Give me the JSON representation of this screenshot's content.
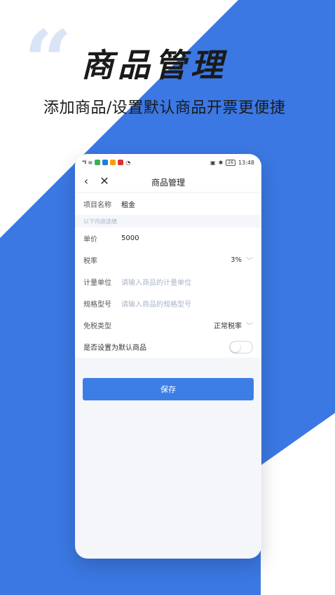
{
  "hero": {
    "quote_glyph": "“",
    "title": "商品管理",
    "subtitle": "添加商品/设置默认商品开票更便捷"
  },
  "colors": {
    "accent": "#3d7ee6",
    "background_blue": "#3b78e3"
  },
  "status_bar": {
    "signal": "⁴⁶ıl",
    "time": "13:48",
    "battery": "26"
  },
  "nav": {
    "title": "商品管理"
  },
  "form": {
    "project_name": {
      "label": "项目名称",
      "value": "租金"
    },
    "section_hint": "以下内容选填",
    "unit_price": {
      "label": "单价",
      "value": "5000"
    },
    "tax_rate": {
      "label": "税率",
      "value": "3%"
    },
    "measure_unit": {
      "label": "计量单位",
      "placeholder": "请输入商品的计量单位"
    },
    "spec_model": {
      "label": "规格型号",
      "placeholder": "请输入商品的规格型号"
    },
    "exemption_type": {
      "label": "免税类型",
      "value": "正常税率"
    },
    "default_product": {
      "label": "是否设置为默认商品",
      "enabled": false
    }
  },
  "save_button": {
    "label": "保存"
  }
}
